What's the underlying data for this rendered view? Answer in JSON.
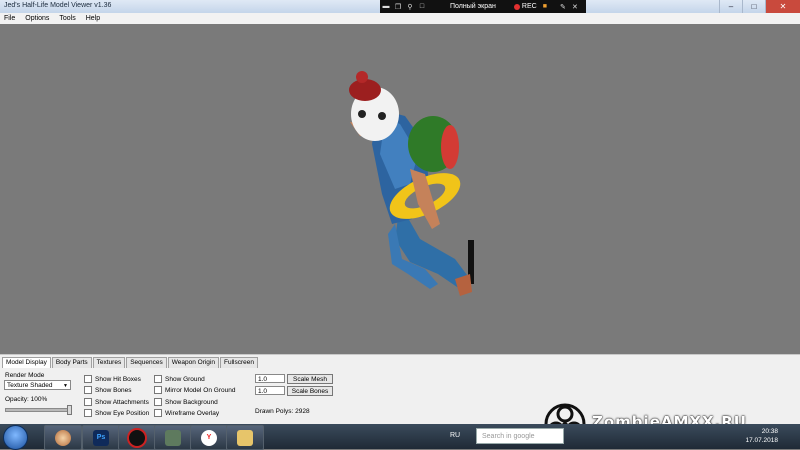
{
  "window": {
    "title": "Jed's Half-Life Model Viewer v1.36"
  },
  "recorder": {
    "fullscreen_label": "Полный экран",
    "rec_label": "REC"
  },
  "menu": {
    "items": [
      "File",
      "Options",
      "Tools",
      "Help"
    ]
  },
  "tabs": [
    "Model Display",
    "Body Parts",
    "Textures",
    "Sequences",
    "Weapon Origin",
    "Fullscreen"
  ],
  "model_display": {
    "render_mode_label": "Render Mode",
    "render_mode_value": "Texture Shaded",
    "opacity_label": "Opacity: 100%",
    "opacity_value": 1.0,
    "checkboxes_col1": [
      "Show Hit Boxes",
      "Show Bones",
      "Show Attachments",
      "Show Eye Position"
    ],
    "checkboxes_col2": [
      "Show Ground",
      "Mirror Model On Ground",
      "Show Background",
      "Wireframe Overlay"
    ],
    "scale_mesh_value": "1.0",
    "scale_mesh_button": "Scale Mesh",
    "scale_bones_value": "1.0",
    "scale_bones_button": "Scale Bones",
    "drawn_polys": "Drawn Polys: 2928"
  },
  "taskbar": {
    "language": "RU",
    "search_placeholder": "Search in google",
    "time": "20:38",
    "date": "17.07.2018",
    "apps": [
      "chrome-like-icon",
      "photoshop-icon",
      "record-icon",
      "game-icon",
      "yandex-icon",
      "folder-icon"
    ],
    "photoshop_label": "Ps",
    "yandex_label": "Y"
  },
  "watermark": {
    "text": "ZombieAMXX.RU"
  },
  "colors": {
    "viewport": "#7a7a7a",
    "accent_red": "#c94a3d"
  }
}
